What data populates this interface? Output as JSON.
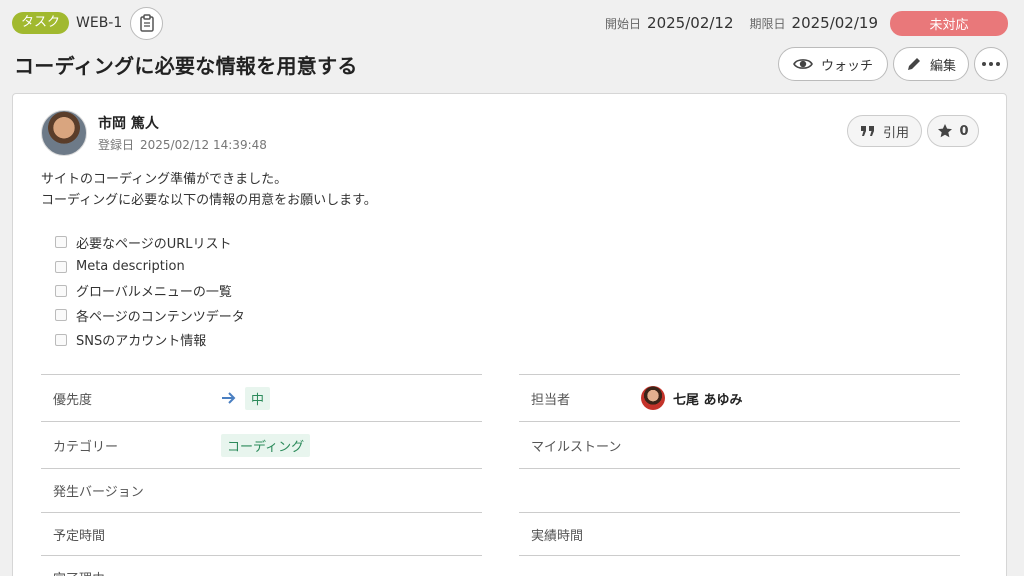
{
  "header": {
    "issue_type": "タスク",
    "issue_key": "WEB-1",
    "start_label": "開始日",
    "start_date": "2025/02/12",
    "due_label": "期限日",
    "due_date": "2025/02/19",
    "status": "未対応"
  },
  "title": "コーディングに必要な情報を用意する",
  "actions": {
    "watch": "ウォッチ",
    "edit": "編集"
  },
  "comment": {
    "author": "市岡 篤人",
    "registered_label": "登録日",
    "registered_at": "2025/02/12 14:39:48",
    "quote": "引用",
    "star_count": "0",
    "lines": [
      "サイトのコーディング準備ができました。",
      "コーディングに必要な以下の情報の用意をお願いします。"
    ],
    "checklist": [
      "必要なページのURLリスト",
      "Meta description",
      "グローバルメニューの一覧",
      "各ページのコンテンツデータ",
      "SNSのアカウント情報"
    ]
  },
  "properties": {
    "priority_label": "優先度",
    "priority_value": "中",
    "assignee_label": "担当者",
    "assignee_value": "七尾 あゆみ",
    "category_label": "カテゴリー",
    "category_value": "コーディング",
    "milestone_label": "マイルストーン",
    "version_label": "発生バージョン",
    "estimated_label": "予定時間",
    "actual_label": "実績時間",
    "resolution_label": "完了理由"
  },
  "colors": {
    "type_badge": "#a1b92f",
    "status_badge": "#e9787a",
    "accent_green": "#2b8a5a",
    "arrow_blue": "#4a7fc1"
  }
}
